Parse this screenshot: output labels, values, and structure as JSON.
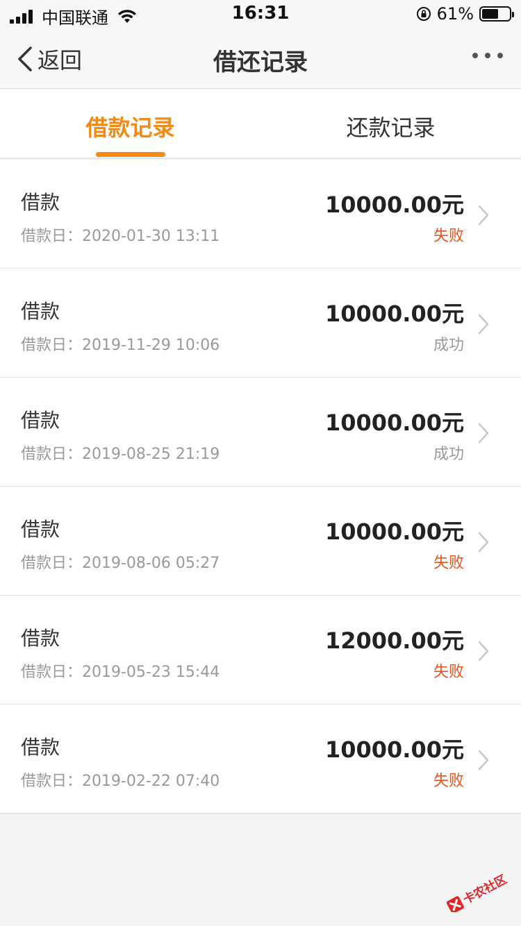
{
  "status_bar": {
    "carrier": "中国联通",
    "time": "16:31",
    "battery_percent": "61%",
    "battery_level": 0.61
  },
  "nav": {
    "back_label": "返回",
    "title": "借还记录"
  },
  "tabs": [
    {
      "label": "借款记录",
      "active": true
    },
    {
      "label": "还款记录",
      "active": false
    }
  ],
  "records": [
    {
      "type": "借款",
      "date": "借款日：2020-01-30 13:11",
      "amount": "10000.00元",
      "status": "失败",
      "status_kind": "fail"
    },
    {
      "type": "借款",
      "date": "借款日：2019-11-29 10:06",
      "amount": "10000.00元",
      "status": "成功",
      "status_kind": "ok"
    },
    {
      "type": "借款",
      "date": "借款日：2019-08-25 21:19",
      "amount": "10000.00元",
      "status": "成功",
      "status_kind": "ok"
    },
    {
      "type": "借款",
      "date": "借款日：2019-08-06 05:27",
      "amount": "10000.00元",
      "status": "失败",
      "status_kind": "fail"
    },
    {
      "type": "借款",
      "date": "借款日：2019-05-23 15:44",
      "amount": "12000.00元",
      "status": "失败",
      "status_kind": "fail"
    },
    {
      "type": "借款",
      "date": "借款日：2019-02-22 07:40",
      "amount": "10000.00元",
      "status": "失败",
      "status_kind": "fail"
    }
  ],
  "watermark": "卡农社区",
  "colors": {
    "accent": "#f48a14",
    "fail": "#e8541e",
    "muted": "#999999"
  }
}
